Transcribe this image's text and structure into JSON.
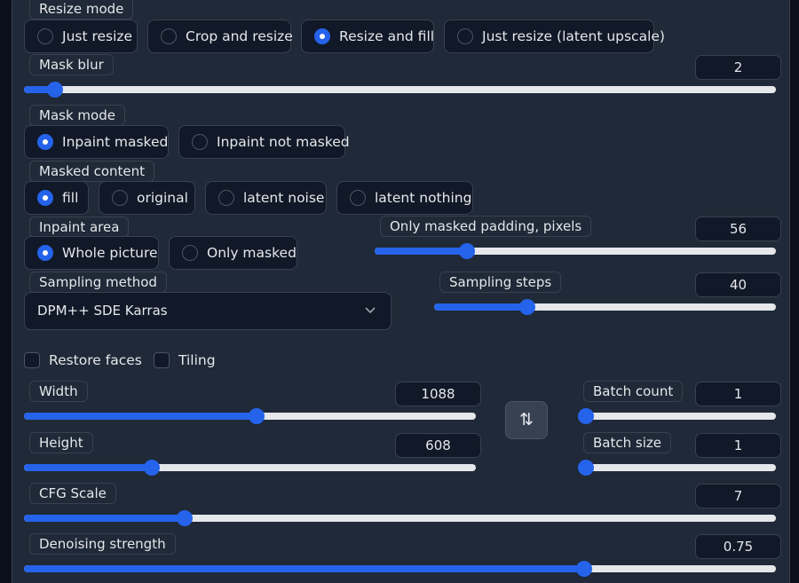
{
  "resize_mode": {
    "label": "Resize mode",
    "options": [
      "Just resize",
      "Crop and resize",
      "Resize and fill",
      "Just resize (latent upscale)"
    ],
    "selected": "Resize and fill"
  },
  "mask_blur": {
    "label": "Mask blur",
    "value": "2",
    "min": 0,
    "max": 64,
    "current": 2
  },
  "mask_mode": {
    "label": "Mask mode",
    "options": [
      "Inpaint masked",
      "Inpaint not masked"
    ],
    "selected": "Inpaint masked"
  },
  "masked_content": {
    "label": "Masked content",
    "options": [
      "fill",
      "original",
      "latent noise",
      "latent nothing"
    ],
    "selected": "fill"
  },
  "inpaint_area": {
    "label": "Inpaint area",
    "options": [
      "Whole picture",
      "Only masked"
    ],
    "selected": "Whole picture"
  },
  "only_masked_padding": {
    "label": "Only masked padding, pixels",
    "value": "56",
    "min": 0,
    "max": 256,
    "current": 56
  },
  "sampling_method": {
    "label": "Sampling method",
    "value": "DPM++ SDE Karras",
    "icon": "chevron-down-icon"
  },
  "sampling_steps": {
    "label": "Sampling steps",
    "value": "40",
    "min": 1,
    "max": 150,
    "current": 40
  },
  "checkboxes": {
    "restore_faces": "Restore faces",
    "tiling": "Tiling"
  },
  "width": {
    "label": "Width",
    "value": "1088",
    "min": 64,
    "max": 2048,
    "current": 1088
  },
  "height": {
    "label": "Height",
    "value": "608",
    "min": 64,
    "max": 2048,
    "current": 608
  },
  "swap_button": {
    "label": "⇅",
    "icon": "swap-vertical-icon"
  },
  "batch_count": {
    "label": "Batch count",
    "value": "1",
    "min": 1,
    "max": 100,
    "current": 1
  },
  "batch_size": {
    "label": "Batch size",
    "value": "1",
    "min": 1,
    "max": 8,
    "current": 1
  },
  "cfg_scale": {
    "label": "CFG Scale",
    "value": "7",
    "min": 1,
    "max": 30,
    "current": 7
  },
  "denoising_strength": {
    "label": "Denoising strength",
    "value": "0.75",
    "min": 0,
    "max": 1,
    "current": 0.75
  },
  "colors": {
    "accent": "#2563eb",
    "panel": "#1f2937",
    "input": "#111827",
    "border": "#374151"
  }
}
